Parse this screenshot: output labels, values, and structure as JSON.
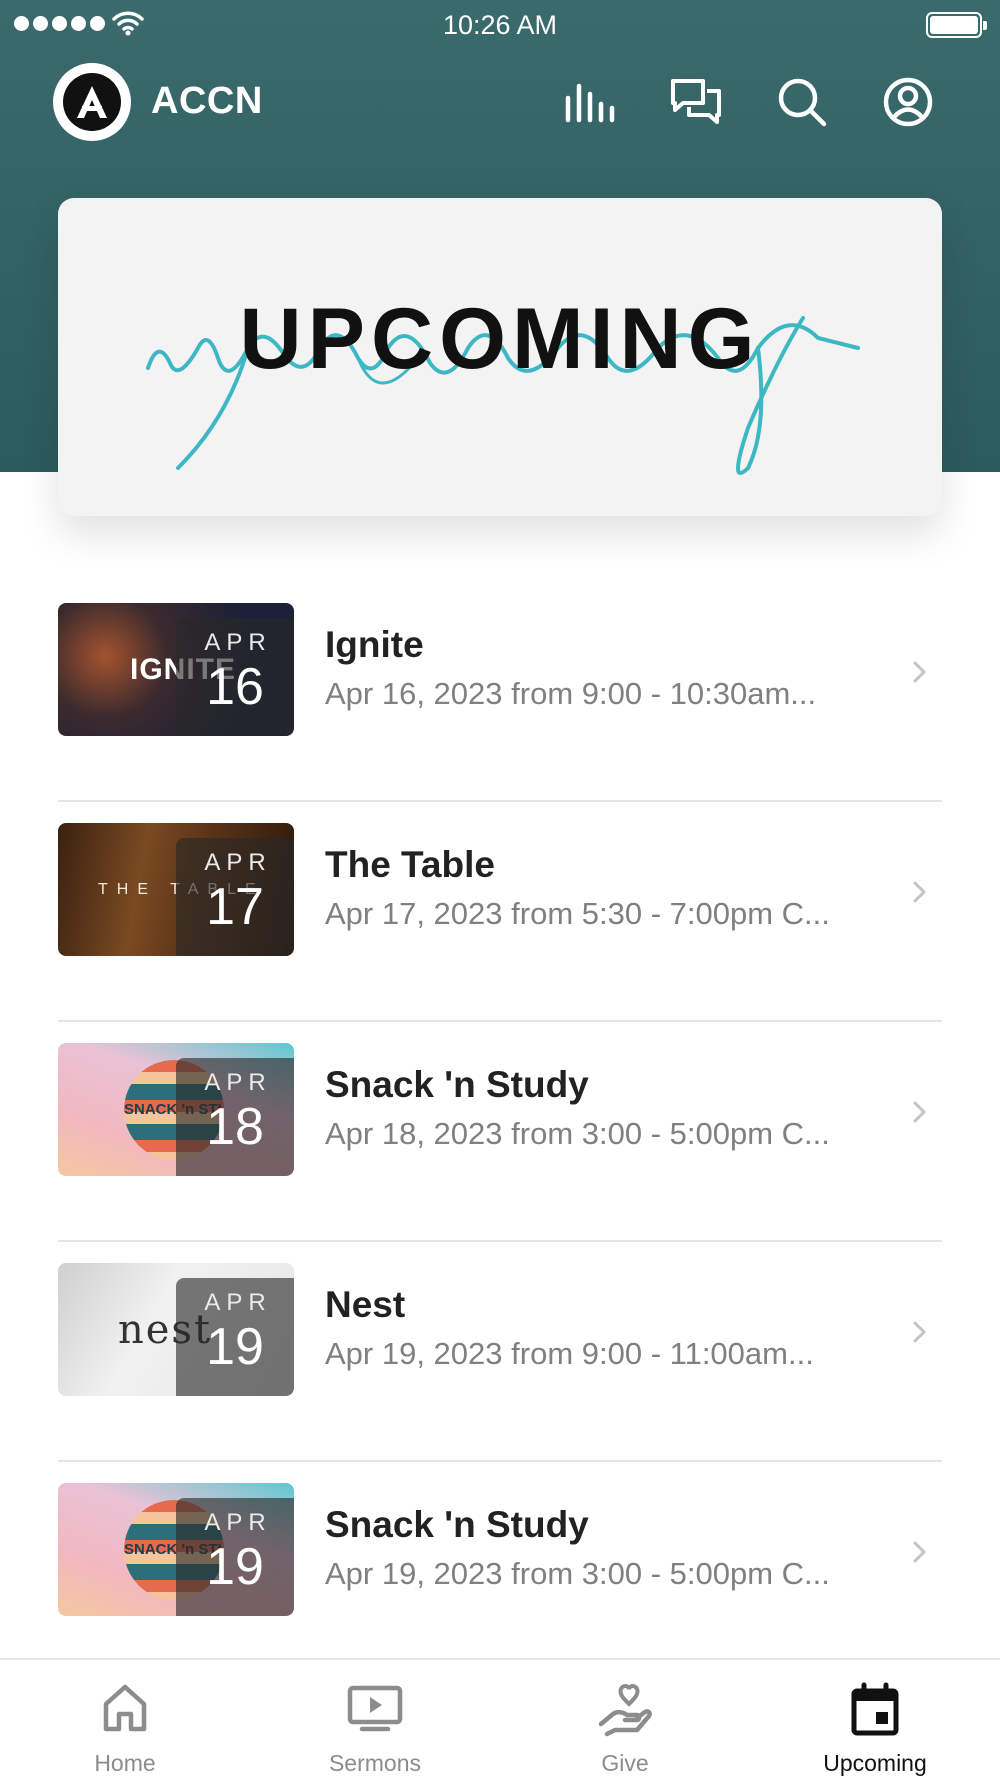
{
  "status_bar": {
    "time": "10:26 AM"
  },
  "app": {
    "title": "ACCN"
  },
  "header_icons": [
    "audio-icon",
    "chat-icon",
    "search-icon",
    "profile-icon"
  ],
  "hero": {
    "title": "UPCOMING",
    "script_text": "upcoming",
    "script_color": "#3db7c4"
  },
  "events": [
    {
      "title": "Ignite",
      "subtitle": "Apr 16, 2023 from 9:00 - 10:30am...",
      "month": "APR",
      "day": "16",
      "thumb_text": "IGNITE"
    },
    {
      "title": "The Table",
      "subtitle": "Apr 17, 2023 from 5:30 - 7:00pm C...",
      "month": "APR",
      "day": "17",
      "thumb_text": "THE TABLE"
    },
    {
      "title": "Snack 'n Study",
      "subtitle": "Apr 18, 2023 from 3:00 - 5:00pm C...",
      "month": "APR",
      "day": "18",
      "thumb_text": "SNACK 'n STUDY"
    },
    {
      "title": "Nest",
      "subtitle": "Apr 19, 2023 from 9:00 - 11:00am...",
      "month": "APR",
      "day": "19",
      "thumb_text": "nest"
    },
    {
      "title": "Snack 'n Study",
      "subtitle": "Apr 19, 2023 from 3:00 - 5:00pm C...",
      "month": "APR",
      "day": "19",
      "thumb_text": "SNACK 'n STUDY"
    }
  ],
  "tabs": [
    {
      "label": "Home",
      "icon": "home-icon",
      "active": false
    },
    {
      "label": "Sermons",
      "icon": "tv-play-icon",
      "active": false
    },
    {
      "label": "Give",
      "icon": "give-hand-heart-icon",
      "active": false
    },
    {
      "label": "Upcoming",
      "icon": "calendar-icon",
      "active": true
    }
  ],
  "colors": {
    "header": "#2f5e60",
    "accent": "#3db7c4",
    "active_tab": "#111111",
    "inactive_tab": "#8c8c8c"
  }
}
